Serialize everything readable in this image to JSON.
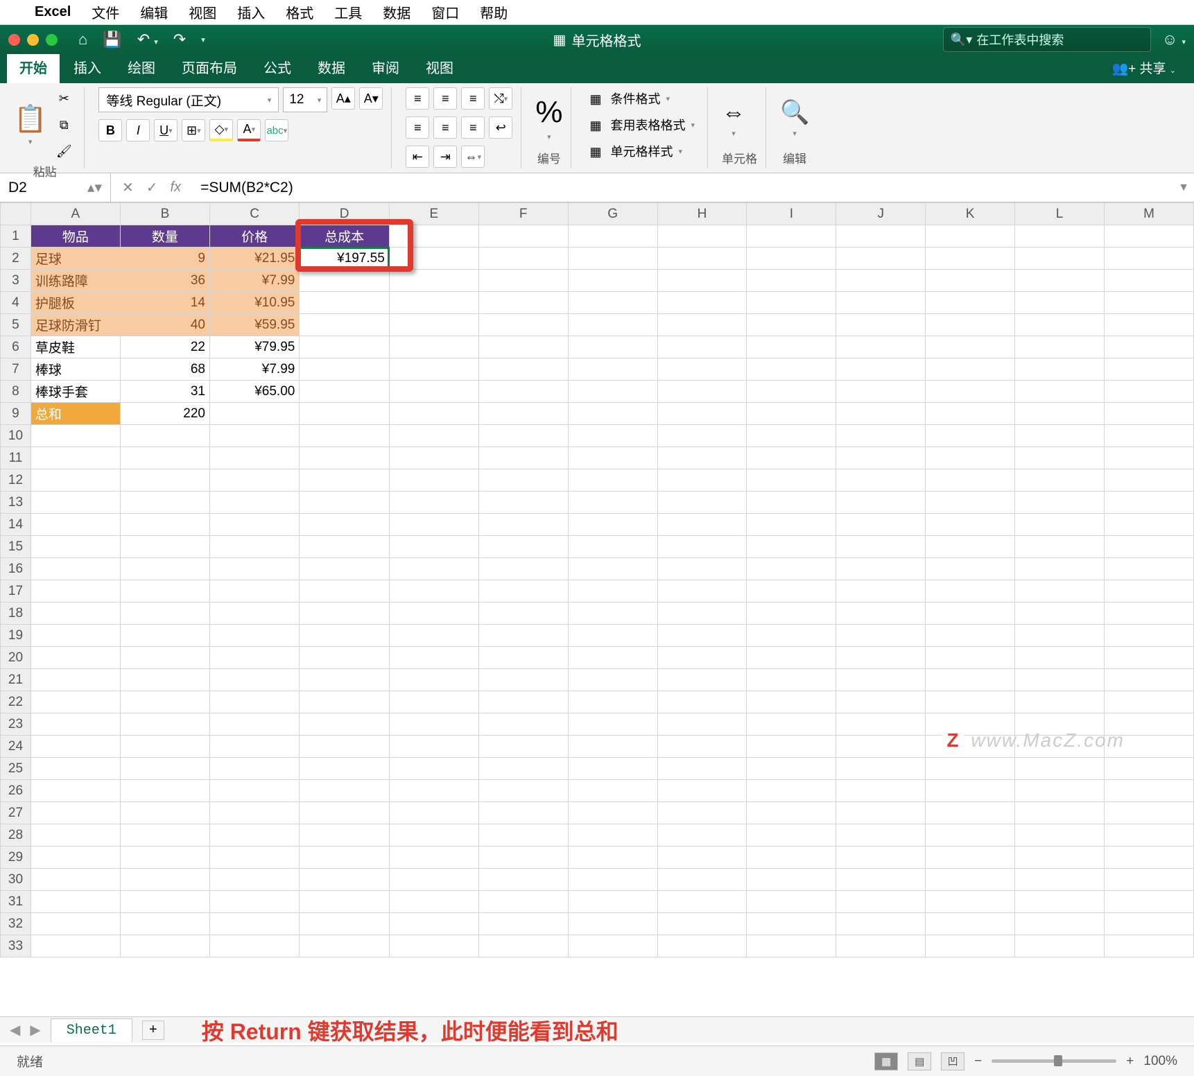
{
  "mac_menu": {
    "app": "Excel",
    "items": [
      "文件",
      "编辑",
      "视图",
      "插入",
      "格式",
      "工具",
      "数据",
      "窗口",
      "帮助"
    ]
  },
  "window": {
    "title": "单元格格式",
    "search_placeholder": "在工作表中搜索"
  },
  "ribbon_tabs": [
    "开始",
    "插入",
    "绘图",
    "页面布局",
    "公式",
    "数据",
    "审阅",
    "视图"
  ],
  "share_label": "共享",
  "ribbon": {
    "paste": "粘贴",
    "font_name": "等线 Regular (正文)",
    "font_size": "12",
    "number_group": "编号",
    "styles": {
      "cond": "条件格式",
      "table": "套用表格格式",
      "cell": "单元格样式"
    },
    "cells_group": "单元格",
    "edit_group": "编辑"
  },
  "formula_bar": {
    "name": "D2",
    "formula": "=SUM(B2*C2)"
  },
  "columns": [
    "A",
    "B",
    "C",
    "D",
    "E",
    "F",
    "G",
    "H",
    "I",
    "J",
    "K",
    "L",
    "M"
  ],
  "headers": [
    "物品",
    "数量",
    "价格",
    "总成本"
  ],
  "rows": [
    {
      "a": "足球",
      "b": "9",
      "c": "¥21.95",
      "d": "¥197.55",
      "cls": "orange"
    },
    {
      "a": "训练路障",
      "b": "36",
      "c": "¥7.99",
      "d": "",
      "cls": "orange"
    },
    {
      "a": "护腿板",
      "b": "14",
      "c": "¥10.95",
      "d": "",
      "cls": "orange"
    },
    {
      "a": "足球防滑钉",
      "b": "40",
      "c": "¥59.95",
      "d": "",
      "cls": "orange"
    },
    {
      "a": "草皮鞋",
      "b": "22",
      "c": "¥79.95",
      "d": "",
      "cls": ""
    },
    {
      "a": "棒球",
      "b": "68",
      "c": "¥7.99",
      "d": "",
      "cls": ""
    },
    {
      "a": "棒球手套",
      "b": "31",
      "c": "¥65.00",
      "d": "",
      "cls": ""
    }
  ],
  "total_row": {
    "label": "总和",
    "b": "220"
  },
  "sheet_name": "Sheet1",
  "caption": "按 Return 键获取结果，此时便能看到总和",
  "status": "就绪",
  "zoom": "100%",
  "watermark": "www.MacZ.com"
}
